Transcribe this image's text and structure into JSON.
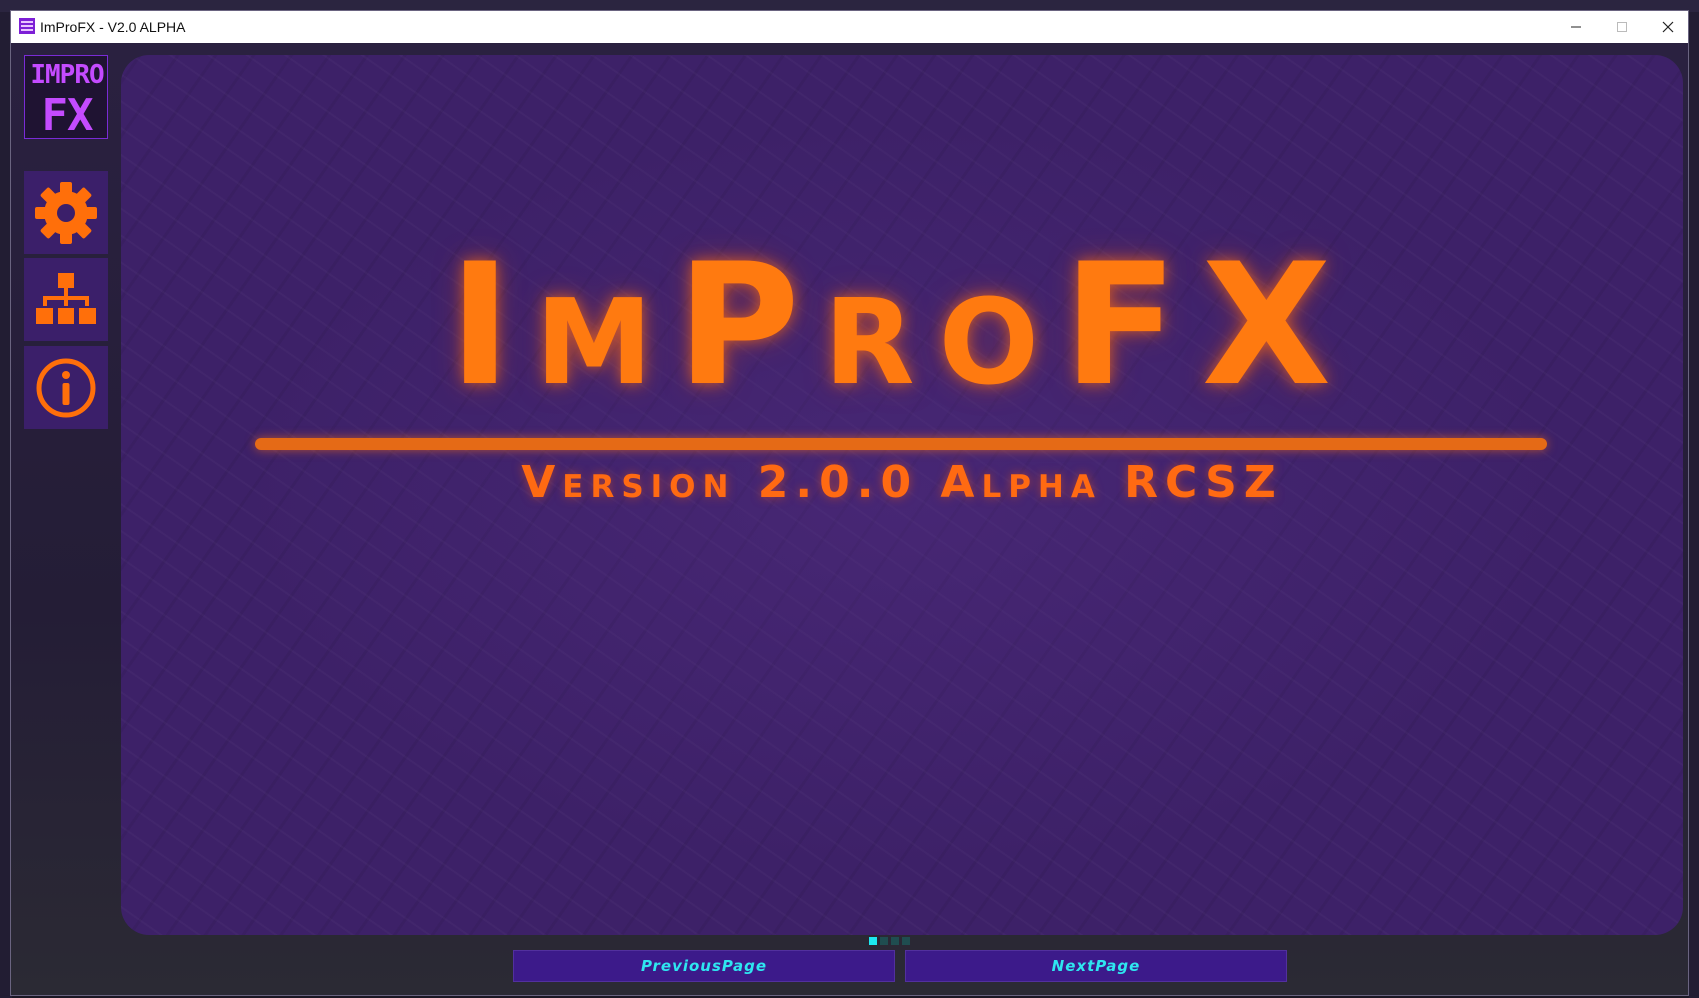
{
  "window": {
    "title": "ImProFX - V2.0 ALPHA"
  },
  "sidebar": {
    "logo_lines": [
      "IMPRO",
      "FX"
    ],
    "buttons": [
      {
        "icon": "gear-icon"
      },
      {
        "icon": "hierarchy-icon"
      },
      {
        "icon": "info-icon"
      }
    ]
  },
  "main": {
    "title": "ImProFX",
    "subtitle": "Version 2.0.0 Alpha RCSZ"
  },
  "pager": {
    "pages": 4,
    "current": 1
  },
  "nav": {
    "prev_label": "PreviousPage",
    "next_label": "NextPage"
  },
  "colors": {
    "accent_orange": "#ff7a10",
    "panel_purple": "#3d2168",
    "button_purple": "#3c1a8a",
    "cyan": "#2ee6f0"
  }
}
